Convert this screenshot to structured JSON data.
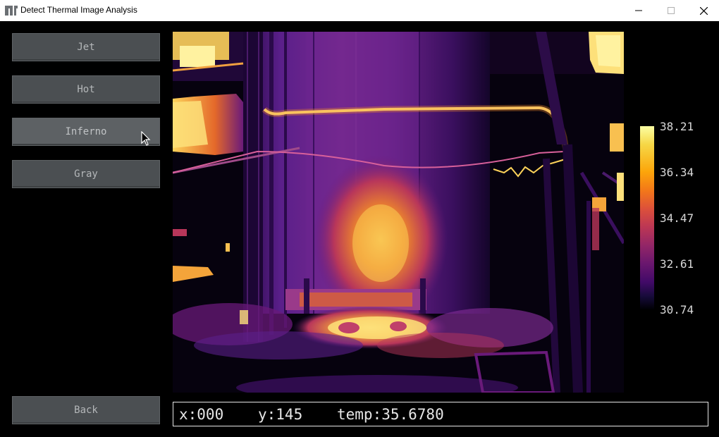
{
  "window": {
    "title": "Detect Thermal Image Analysis",
    "minimize_glyph": "—",
    "maximize_glyph": "☐",
    "close_glyph": "✕"
  },
  "colormaps": [
    {
      "label": "Jet",
      "name": "colormap-button-jet"
    },
    {
      "label": "Hot",
      "name": "colormap-button-hot"
    },
    {
      "label": "Inferno",
      "name": "colormap-button-inferno"
    },
    {
      "label": "Gray",
      "name": "colormap-button-gray"
    }
  ],
  "back_button": {
    "label": "Back"
  },
  "colorbar": {
    "colormap": "inferno",
    "labels": [
      "38.21",
      "36.34",
      "34.47",
      "32.61",
      "30.74"
    ],
    "max": 38.21,
    "min": 30.74
  },
  "status": {
    "x": "x:000",
    "y": "y:145",
    "temp": "temp:35.6780"
  },
  "colors": {
    "background": "#000000",
    "button": "#4b4f52",
    "button_hover": "#5d6164",
    "button_text": "#b4b7b9"
  },
  "icons": {
    "app": "detect-logo-icon",
    "cursor": "mouse-pointer-icon"
  }
}
